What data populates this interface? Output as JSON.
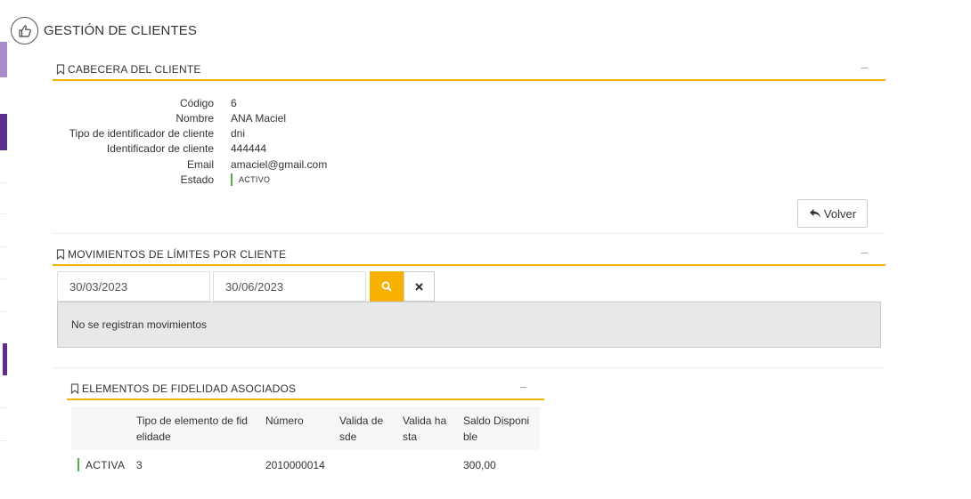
{
  "page": {
    "title": "GESTIÓN DE CLIENTES"
  },
  "colors": {
    "accent": "#f0b400",
    "status_active": "#4caf50",
    "rail_light": "#a88cc8",
    "rail_dark": "#5c2d91"
  },
  "header_section": {
    "title": "CABECERA DEL CLIENTE",
    "minimize_label": "–",
    "fields": [
      {
        "label": "Código",
        "value": "6"
      },
      {
        "label": "Nombre",
        "value": "ANA Maciel"
      },
      {
        "label": "Tipo de identificador de cliente",
        "value": "dni"
      },
      {
        "label": "Identificador de cliente",
        "value": "444444"
      },
      {
        "label": "Email",
        "value": "amaciel@gmail.com"
      },
      {
        "label": "Estado",
        "value": "ACTIVO"
      }
    ],
    "back_button": "Volver"
  },
  "movements_section": {
    "title": "MOVIMIENTOS DE LÍMITES POR CLIENTE",
    "minimize_label": "–",
    "date_from": "30/03/2023",
    "date_to": "30/06/2023",
    "empty_message": "No se registran movimientos"
  },
  "loyalty_section": {
    "title": "ELEMENTOS DE FIDELIDAD ASOCIADOS",
    "minimize_label": "–",
    "columns": [
      "Tipo de elemento de fid\nelidade",
      "Número",
      "Valida de\nsde",
      "Valida ha\nsta",
      "Saldo Disponi\nble"
    ],
    "rows": [
      {
        "status": "ACTIVA",
        "tipo": "3",
        "numero": "2010000014",
        "desde": "",
        "hasta": "",
        "saldo": "300,00"
      }
    ]
  },
  "icons": {
    "page": "thumbs-up-icon",
    "bookmark": "bookmark-icon",
    "back": "reply-arrow-icon",
    "search": "search-icon",
    "clear": "close-icon"
  }
}
